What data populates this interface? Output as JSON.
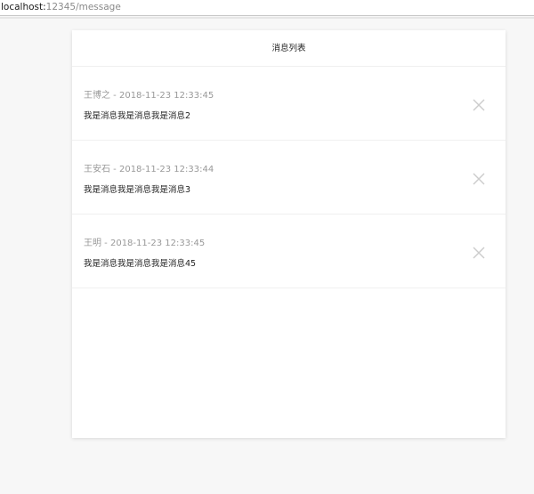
{
  "browser": {
    "url_host": "localhost:",
    "url_rest": "12345/message"
  },
  "panel": {
    "title": "消息列表",
    "messages": [
      {
        "sender": "王博之",
        "separator": " - ",
        "time": "2018-11-23 12:33:45",
        "content": "我是消息我是消息我是消息2",
        "close_icon": "close-icon"
      },
      {
        "sender": "王安石",
        "separator": " - ",
        "time": "2018-11-23 12:33:44",
        "content": "我是消息我是消息我是消息3",
        "close_icon": "close-icon"
      },
      {
        "sender": "王明",
        "separator": " - ",
        "time": "2018-11-23 12:33:45",
        "content": "我是消息我是消息我是消息45",
        "close_icon": "close-icon"
      }
    ]
  },
  "colors": {
    "meta_text": "#999999",
    "body_text": "#222222",
    "close_icon": "#cccccc",
    "page_bg": "#f7f7f7"
  }
}
